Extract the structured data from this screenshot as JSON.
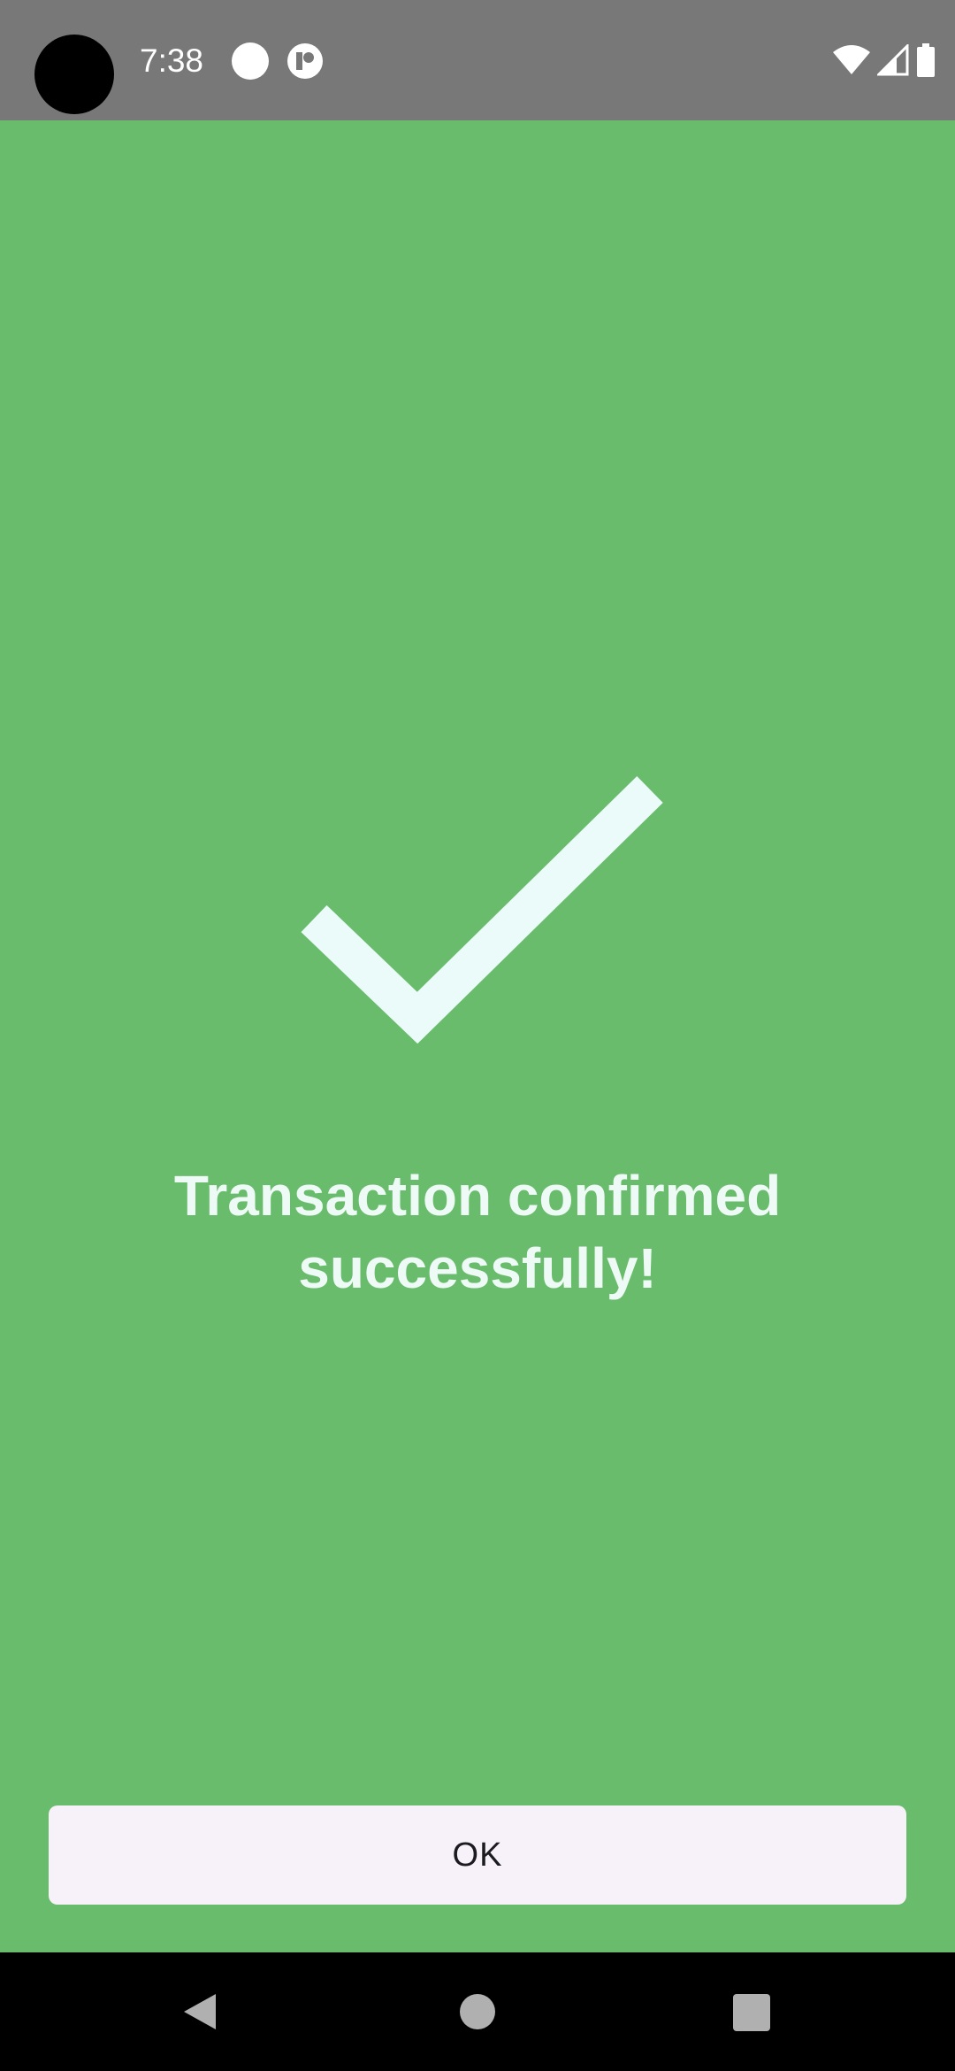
{
  "status_bar": {
    "time": "7:38",
    "icons": [
      "notification-dot-icon",
      "app-notification-icon",
      "wifi-icon",
      "cellular-signal-icon",
      "battery-icon"
    ]
  },
  "main": {
    "icon": "checkmark-icon",
    "message_line1": "Transaction confirmed",
    "message_line2": "successfully!",
    "ok_label": "OK"
  },
  "nav_bar": {
    "icons": [
      "back-icon",
      "home-icon",
      "recents-icon"
    ]
  },
  "colors": {
    "background": "#69bc6b",
    "status_bar": "#787878",
    "checkmark": "#eafbf9",
    "message_text": "#eefaf6",
    "button_background": "#f7f2fa",
    "nav_bar": "#000000"
  }
}
